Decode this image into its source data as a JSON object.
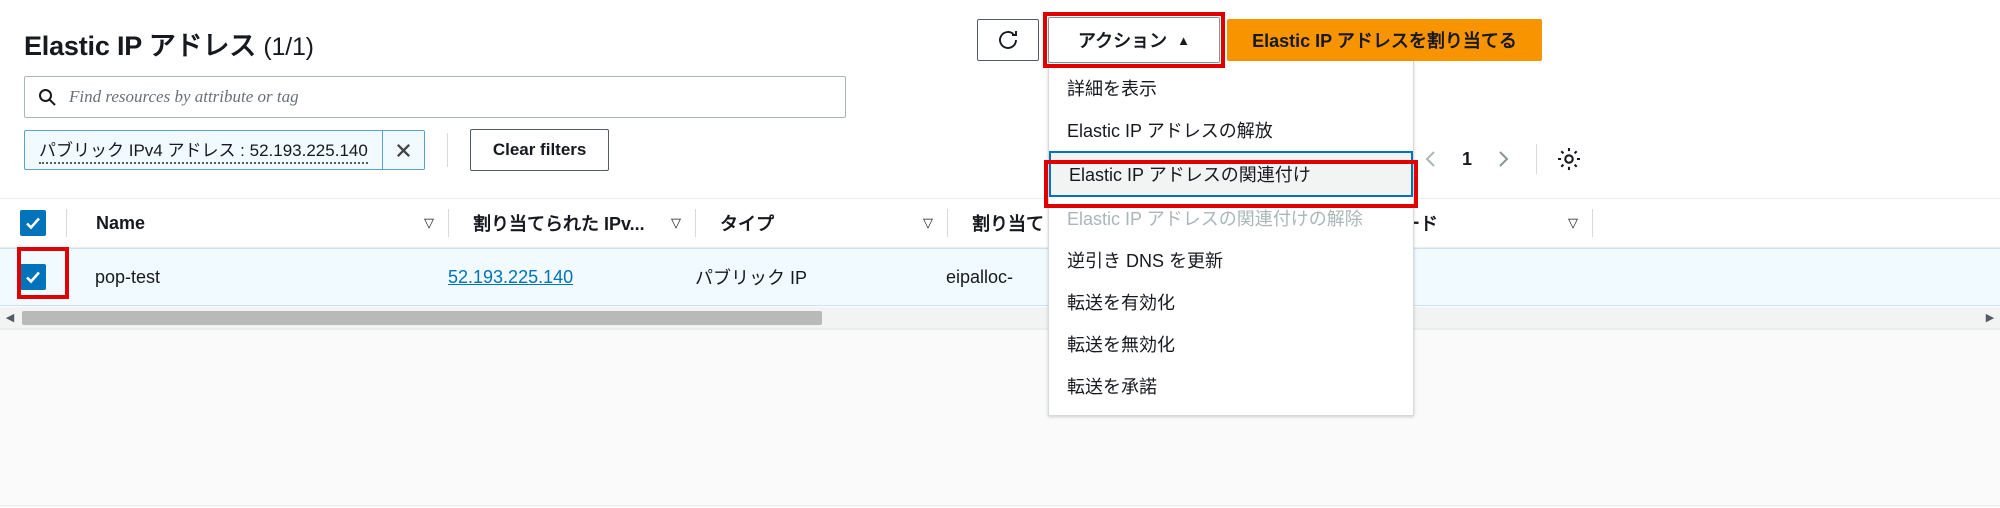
{
  "header": {
    "title": "Elastic IP アドレス",
    "count": "(1/1)"
  },
  "search": {
    "placeholder": "Find resources by attribute or tag",
    "icon": "search-icon"
  },
  "filters": {
    "token_label": "パブリック IPv4 アドレス : 52.193.225.140",
    "dismiss_icon": "close-icon",
    "clear_label": "Clear filters"
  },
  "toolbar": {
    "refresh_icon": "refresh-icon",
    "actions_label": "アクション",
    "actions_caret": "▲",
    "primary_label": "Elastic IP アドレスを割り当てる"
  },
  "pager": {
    "prev_icon": "chevron-left-icon",
    "page": "1",
    "next_icon": "chevron-right-icon",
    "gear_icon": "gear-icon"
  },
  "dropdown": {
    "items": [
      {
        "label": "詳細を表示",
        "state": "normal"
      },
      {
        "label": "Elastic IP アドレスの解放",
        "state": "normal"
      },
      {
        "label": "Elastic IP アドレスの関連付け",
        "state": "highlighted"
      },
      {
        "label": "Elastic IP アドレスの関連付けの解除",
        "state": "disabled"
      },
      {
        "label": "逆引き DNS を更新",
        "state": "normal"
      },
      {
        "label": "転送を有効化",
        "state": "normal"
      },
      {
        "label": "転送を無効化",
        "state": "normal"
      },
      {
        "label": "転送を承諾",
        "state": "normal"
      }
    ]
  },
  "table": {
    "select_all_checked": true,
    "columns": [
      {
        "label": "Name",
        "sort_icon": "▽"
      },
      {
        "label": "割り当てられた IPv...",
        "sort_icon": "▽"
      },
      {
        "label": "タイプ",
        "sort_icon": "▽"
      },
      {
        "label": "割り当て",
        "sort_icon": "▽"
      },
      {
        "label": "ード",
        "sort_icon": "▽"
      }
    ],
    "rows": [
      {
        "checked": true,
        "name": "pop-test",
        "ipv4": "52.193.225.140",
        "type": "パブリック IP",
        "allocation": "eipalloc-"
      }
    ]
  },
  "colors": {
    "accent_link": "#0073bb",
    "primary_button": "#f79400",
    "annotation_red": "#e00000",
    "selected_row": "#f1faff"
  }
}
